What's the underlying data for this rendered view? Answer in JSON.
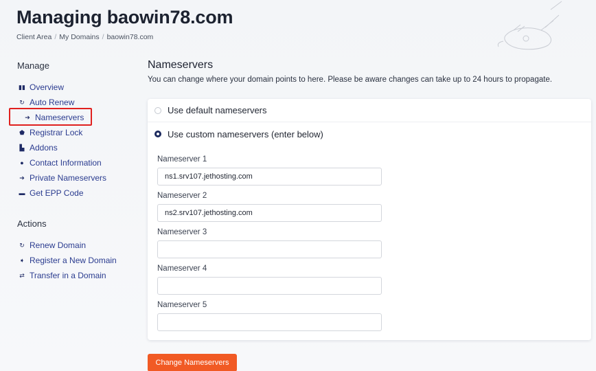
{
  "header": {
    "title": "Managing baowin78.com",
    "breadcrumb": [
      "Client Area",
      "My Domains",
      "baowin78.com"
    ]
  },
  "sidebar": {
    "manage_heading": "Manage",
    "manage_items": [
      {
        "label": "Overview",
        "icon": "overview-icon"
      },
      {
        "label": "Auto Renew",
        "icon": "renew-icon"
      },
      {
        "label": "Nameservers",
        "icon": "arrow-icon",
        "active": true
      },
      {
        "label": "Registrar Lock",
        "icon": "lock-icon"
      },
      {
        "label": "Addons",
        "icon": "addons-icon"
      },
      {
        "label": "Contact Information",
        "icon": "user-icon"
      },
      {
        "label": "Private Nameservers",
        "icon": "arrow-icon"
      },
      {
        "label": "Get EPP Code",
        "icon": "code-icon"
      }
    ],
    "actions_heading": "Actions",
    "action_items": [
      {
        "label": "Renew Domain",
        "icon": "renew-icon"
      },
      {
        "label": "Register a New Domain",
        "icon": "tag-icon"
      },
      {
        "label": "Transfer in a Domain",
        "icon": "transfer-icon"
      }
    ]
  },
  "main": {
    "title": "Nameservers",
    "description": "You can change where your domain points to here. Please be aware changes can take up to 24 hours to propagate.",
    "options": [
      {
        "label": "Use default nameservers",
        "checked": false
      },
      {
        "label": "Use custom nameservers (enter below)",
        "checked": true
      }
    ],
    "nameservers": [
      {
        "label": "Nameserver 1",
        "value": "ns1.srv107.jethosting.com"
      },
      {
        "label": "Nameserver 2",
        "value": "ns2.srv107.jethosting.com"
      },
      {
        "label": "Nameserver 3",
        "value": ""
      },
      {
        "label": "Nameserver 4",
        "value": ""
      },
      {
        "label": "Nameserver 5",
        "value": ""
      }
    ],
    "submit_label": "Change Nameservers"
  },
  "colors": {
    "accent": "#f15a24",
    "link": "#2a3b8f",
    "highlight_box": "#e0201e"
  }
}
